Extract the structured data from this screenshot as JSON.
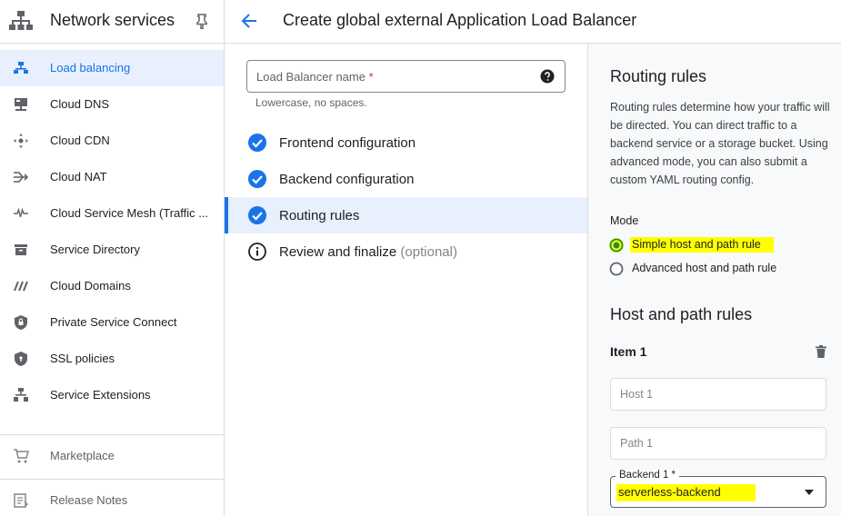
{
  "sidebar": {
    "title": "Network services",
    "items": [
      {
        "label": "Load balancing"
      },
      {
        "label": "Cloud DNS"
      },
      {
        "label": "Cloud CDN"
      },
      {
        "label": "Cloud NAT"
      },
      {
        "label": "Cloud Service Mesh (Traffic ..."
      },
      {
        "label": "Service Directory"
      },
      {
        "label": "Cloud Domains"
      },
      {
        "label": "Private Service Connect"
      },
      {
        "label": "SSL policies"
      },
      {
        "label": "Service Extensions"
      }
    ],
    "marketplace": "Marketplace",
    "release_notes": "Release Notes"
  },
  "header": {
    "title": "Create global external Application Load Balancer"
  },
  "form": {
    "name_placeholder": "Load Balancer name",
    "required_mark": "*",
    "name_hint": "Lowercase, no spaces."
  },
  "steps": [
    {
      "label": "Frontend configuration"
    },
    {
      "label": "Backend configuration"
    },
    {
      "label": "Routing rules"
    },
    {
      "label": "Review and finalize",
      "suffix": "(optional)"
    }
  ],
  "routing": {
    "title": "Routing rules",
    "description": "Routing rules determine how your traffic will be directed. You can direct traffic to a backend service or a storage bucket. Using advanced mode, you can also submit a custom YAML routing config.",
    "mode_label": "Mode",
    "mode_options": [
      {
        "label": "Simple host and path rule",
        "selected": true
      },
      {
        "label": "Advanced host and path rule",
        "selected": false
      }
    ],
    "host_path_title": "Host and path rules",
    "item_title": "Item 1",
    "host_placeholder": "Host 1",
    "path_placeholder": "Path 1",
    "backend_label": "Backend 1 *",
    "backend_value": "serverless-backend"
  },
  "colors": {
    "accent": "#1a73e8",
    "highlight": "#ffff00",
    "active_bg": "#e8f0fe",
    "required": "#d93025"
  }
}
